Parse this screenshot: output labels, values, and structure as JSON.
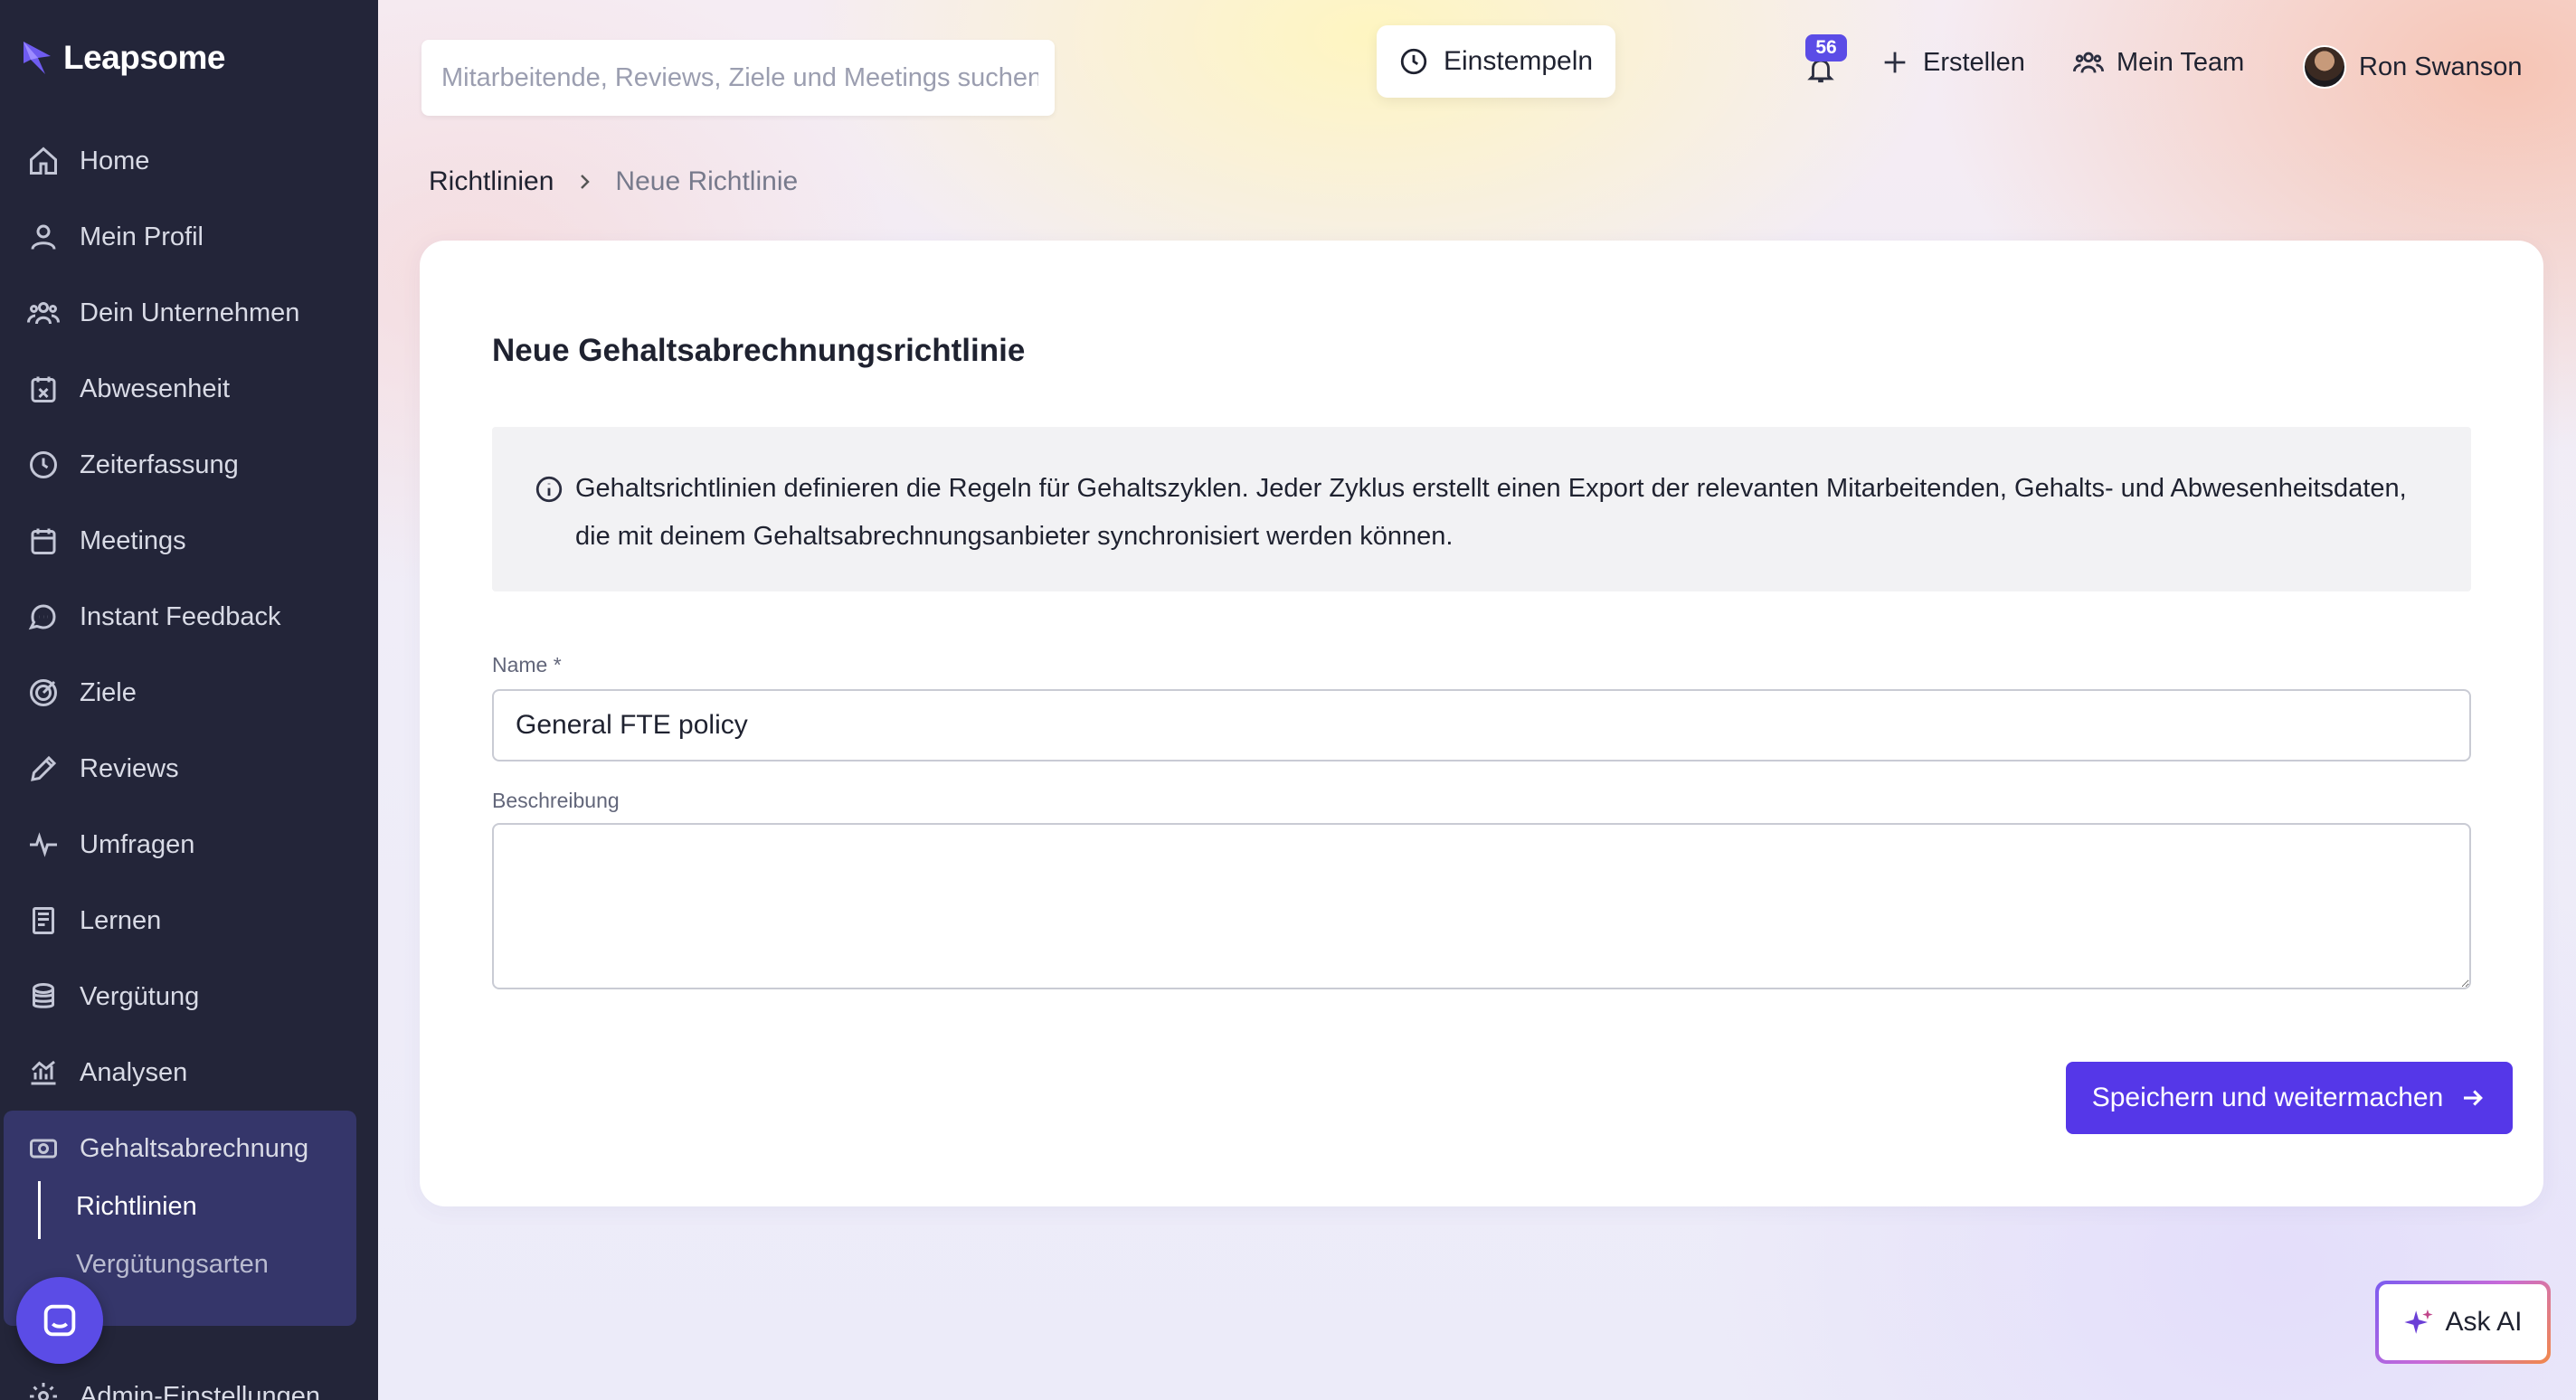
{
  "app": {
    "brand": "Leapsome",
    "accent_color": "#5537e8",
    "sidebar_color": "#232539"
  },
  "sidebar": {
    "items": [
      {
        "label": "Home",
        "icon": "home-icon"
      },
      {
        "label": "Mein Profil",
        "icon": "user-icon"
      },
      {
        "label": "Dein Unternehmen",
        "icon": "users-icon"
      },
      {
        "label": "Abwesenheit",
        "icon": "calendar-x-icon"
      },
      {
        "label": "Zeiterfassung",
        "icon": "clock-icon"
      },
      {
        "label": "Meetings",
        "icon": "calendar-icon"
      },
      {
        "label": "Instant Feedback",
        "icon": "chat-icon"
      },
      {
        "label": "Ziele",
        "icon": "target-icon"
      },
      {
        "label": "Reviews",
        "icon": "pencil-icon"
      },
      {
        "label": "Umfragen",
        "icon": "pulse-icon"
      },
      {
        "label": "Lernen",
        "icon": "book-icon"
      },
      {
        "label": "Vergütung",
        "icon": "coins-icon"
      },
      {
        "label": "Analysen",
        "icon": "chart-icon"
      }
    ],
    "active_group": {
      "label": "Gehaltsabrechnung",
      "icon": "money-icon",
      "sub_items": [
        "Richtlinien",
        "Vergütungsarten"
      ],
      "active_sub": "Richtlinien"
    },
    "admin": {
      "label": "Admin-Einstellungen",
      "icon": "gear-icon"
    }
  },
  "header": {
    "search_placeholder": "Mitarbeitende, Reviews, Ziele und Meetings suchen",
    "clock_in_label": "Einstempeln",
    "notification_count": "56",
    "create_label": "Erstellen",
    "team_label": "Mein Team",
    "user_name": "Ron Swanson"
  },
  "breadcrumb": {
    "parent": "Richtlinien",
    "current": "Neue Richtlinie"
  },
  "form": {
    "title": "Neue Gehaltsabrechnungsrichtlinie",
    "info": "Gehaltsrichtlinien definieren die Regeln für Gehaltszyklen. Jeder Zyklus erstellt einen Export der relevanten Mitarbeitenden, Gehalts- und Abwesenheitsdaten, die mit deinem Gehaltsabrechnungsanbieter synchronisiert werden können.",
    "name_label": "Name *",
    "name_value": "General FTE policy",
    "description_label": "Beschreibung",
    "description_value": "",
    "submit_label": "Speichern und weitermachen"
  },
  "ask_ai": {
    "label": "Ask AI"
  }
}
